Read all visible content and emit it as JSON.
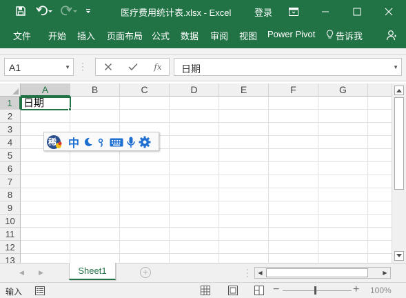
{
  "app": {
    "window_title": "医疗费用统计表.xlsx - Excel",
    "sign_in": "登录",
    "theme_color": "#217346"
  },
  "quick_access": {
    "icons": [
      "save-icon",
      "undo-icon",
      "redo-icon",
      "customize-qat-icon"
    ]
  },
  "window_controls": [
    "ribbon-display-options-icon",
    "minimize-icon",
    "maximize-icon",
    "close-icon"
  ],
  "ribbon": {
    "tabs": [
      "文件",
      "开始",
      "插入",
      "页面布局",
      "公式",
      "数据",
      "审阅",
      "视图",
      "Power Pivot"
    ],
    "tell_me": "告诉我",
    "share_icon": "share-user-icon"
  },
  "formula_bar": {
    "name_box": "A1",
    "cancel_icon": "✕",
    "enter_icon": "✓",
    "function_label": "fx",
    "content": "日期"
  },
  "grid": {
    "columns": [
      "A",
      "B",
      "C",
      "D",
      "E",
      "F",
      "G"
    ],
    "rows": [
      "1",
      "2",
      "3",
      "4",
      "5",
      "6",
      "7",
      "8",
      "9",
      "10",
      "11",
      "12",
      "13"
    ],
    "selected_cell": "A1",
    "cells": {
      "A1": "日期"
    }
  },
  "ime_toolbar": {
    "logo_char": "稀",
    "mode": "中",
    "icons": [
      "ime-logo-icon",
      "chinese-mode-icon",
      "half-width-moon-icon",
      "punctuation-icon",
      "soft-keyboard-icon",
      "microphone-icon",
      "settings-gear-icon"
    ]
  },
  "sheets": {
    "tabs": [
      "Sheet1"
    ],
    "active": "Sheet1"
  },
  "status_bar": {
    "mode_text": "输入",
    "zoom_level": "100%",
    "views": [
      "normal-view-icon",
      "page-layout-view-icon",
      "page-break-preview-icon"
    ]
  }
}
